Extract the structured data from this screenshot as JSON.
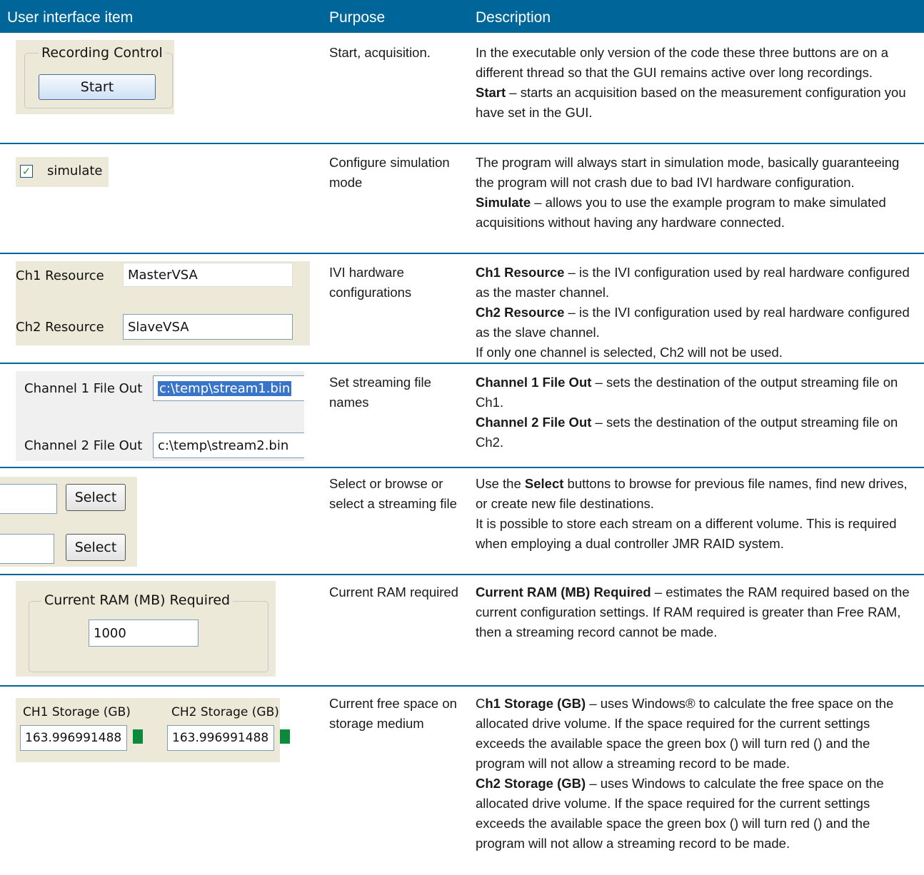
{
  "header": {
    "col_item": "User interface item",
    "col_purpose": "Purpose",
    "col_description": "Description"
  },
  "colors": {
    "header_bg": "#006699",
    "status_green": "#0a8a3a",
    "panel_bg": "#ece9d8"
  },
  "rows": [
    {
      "purpose": "Start, acquisition.",
      "desc": [
        {
          "plain": "In the executable only version of the code these three buttons are on a different thread so that the GUI remains active over long recordings."
        },
        {
          "bold": "Start",
          "rest": " – starts an acquisition based on the measurement configuration you have set in the GUI."
        }
      ],
      "ui": {
        "group_label": "Recording Control",
        "button": "Start"
      }
    },
    {
      "purpose": "Configure simulation mode",
      "desc": [
        {
          "plain": "The program will always start in simulation mode, basically guaranteeing the program will not crash due to bad IVI hardware configuration."
        },
        {
          "bold": "Simulate",
          "rest": " – allows you to use the example program to make simulated acquisitions without having any hardware connected."
        }
      ],
      "ui": {
        "checkbox_label": "simulate",
        "checked_glyph": "✓"
      }
    },
    {
      "purpose": "IVI hardware configurations",
      "desc": [
        {
          "bold": "Ch1 Resource",
          "rest": " – is the IVI configuration used by real hardware configured as the master channel."
        },
        {
          "bold": "Ch2 Resource",
          "rest": " – is the IVI configuration used by real hardware configured as the slave channel."
        },
        {
          "plain": "If only one channel is selected, Ch2 will not be used."
        }
      ],
      "ui": {
        "ch1_label": "Ch1 Resource",
        "ch1_value": "MasterVSA",
        "ch2_label": "Ch2 Resource",
        "ch2_value": "SlaveVSA"
      }
    },
    {
      "purpose": "Set streaming file names",
      "desc": [
        {
          "bold": "Channel 1 File Out",
          "rest": " – sets the destination of the output streaming file on Ch1."
        },
        {
          "bold": "Channel 2 File Out",
          "rest": " – sets the destination of the output streaming file on Ch2."
        }
      ],
      "ui": {
        "ch1_label": "Channel 1 File Out",
        "ch1_value": "c:\\temp\\stream1.bin",
        "ch2_label": "Channel 2 File Out",
        "ch2_value": "c:\\temp\\stream2.bin"
      }
    },
    {
      "purpose": "Select or browse or select a streaming file",
      "desc": [
        {
          "pre": "Use the ",
          "bold": "Select",
          "rest": " buttons to browse for previous file names, find new drives, or create new file destinations."
        },
        {
          "plain": "It is possible to store each stream on a different volume. This is required when employing a dual controller JMR RAID system."
        }
      ],
      "ui": {
        "button1": "Select",
        "button2": "Select"
      }
    },
    {
      "purpose": "Current RAM required",
      "desc": [
        {
          "bold": "Current RAM (MB) Required",
          "rest": " – estimates the RAM required based on the current configuration settings. If RAM required is greater than Free RAM, then a streaming record cannot be made."
        }
      ],
      "ui": {
        "group_label": "Current RAM (MB) Required",
        "value": "1000"
      }
    },
    {
      "purpose": "Current free space on storage medium",
      "desc": [
        {
          "pre": "C",
          "bold": "h1 Storage (GB)",
          "rest": " – uses Windows® to calculate the free space on the allocated drive volume. If the space required for the current settings exceeds the available space the green box () will turn red () and the program will not allow a streaming record to be made."
        },
        {
          "bold": "Ch2 Storage (GB)",
          "rest": " – uses Windows to calculate the free space on the allocated drive volume. If the space required for the current settings exceeds the available space the green box () will turn red () and the program will not allow a streaming record to be made."
        }
      ],
      "ui": {
        "ch1_label": "CH1 Storage (GB)",
        "ch1_value": "163.996991488",
        "ch2_label": "CH2 Storage (GB)",
        "ch2_value": "163.996991488"
      }
    }
  ]
}
